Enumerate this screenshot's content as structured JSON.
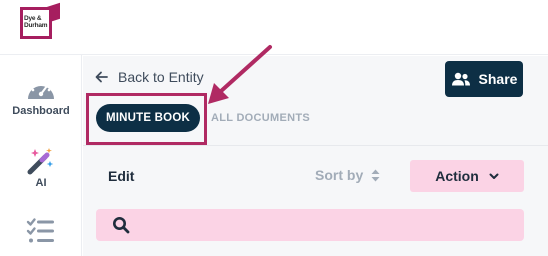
{
  "logo": {
    "line1": "Dye &",
    "line2": "Durham"
  },
  "sidebar": {
    "items": [
      {
        "label": "Dashboard",
        "icon": "gauge-icon"
      },
      {
        "label": "AI",
        "icon": "magic-wand-icon"
      },
      {
        "label": "",
        "icon": "checklist-icon"
      }
    ]
  },
  "header": {
    "back_label": "Back to Entity",
    "share_label": "Share"
  },
  "tabs": [
    {
      "label": "MINUTE BOOK",
      "active": true
    },
    {
      "label": "ALL DOCUMENTS",
      "active": false
    }
  ],
  "toolbar": {
    "edit_label": "Edit",
    "sort_label": "Sort by",
    "action_label": "Action"
  },
  "search": {
    "placeholder": ""
  },
  "colors": {
    "brand": "#a61e5f",
    "primary_dark": "#0d2f45",
    "accent_pink": "#fbd3e5",
    "annotation": "#b02a63"
  }
}
